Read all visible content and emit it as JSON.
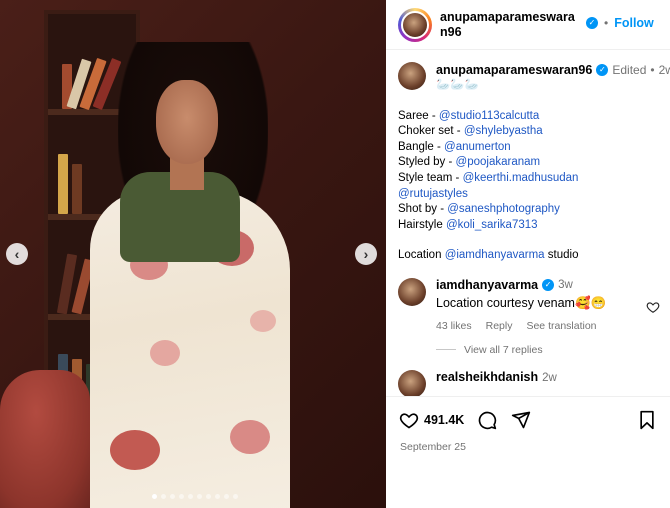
{
  "post": {
    "author": "anupamaparameswaran96",
    "follow_label": "Follow",
    "caption": {
      "edited_label": "Edited",
      "age": "2w",
      "emoji": "🦢🦢🦢",
      "lines": [
        {
          "label": "Saree - ",
          "mention": "@studio113calcutta"
        },
        {
          "label": "Choker set - ",
          "mention": "@shylebyastha"
        },
        {
          "label": "Bangle - ",
          "mention": "@anumerton"
        },
        {
          "label": "Styled by - ",
          "mention": "@poojakaranam"
        },
        {
          "label": "Style team - ",
          "mention": "@keerthi.madhusudan"
        },
        {
          "label": "",
          "mention": "@rutujastyles"
        },
        {
          "label": "Shot by - ",
          "mention": "@saneshphotography"
        },
        {
          "label": "Hairstyle ",
          "mention": "@koli_sarika7313"
        }
      ],
      "location_label": "Location ",
      "location_mention": "@iamdhanyavarma",
      "location_suffix": " studio"
    },
    "likes": "491.4K",
    "date": "September 25",
    "carousel_count": 10
  },
  "comments": [
    {
      "user": "iamdhanyavarma",
      "age": "3w",
      "text": "Location courtesy venam🥰😁",
      "likes": "43 likes",
      "reply_label": "Reply",
      "translate_label": "See translation",
      "view_replies": "View all 7 replies"
    },
    {
      "user": "realsheikhdanish",
      "age": "2w"
    }
  ],
  "icons": {
    "prev": "chevron-left-icon",
    "next": "chevron-right-icon",
    "like": "heart-icon",
    "comment": "comment-icon",
    "share": "send-icon",
    "save": "bookmark-icon"
  },
  "colors": {
    "accent": "#0095f6",
    "mention": "#1f58c4",
    "muted": "#737373"
  }
}
